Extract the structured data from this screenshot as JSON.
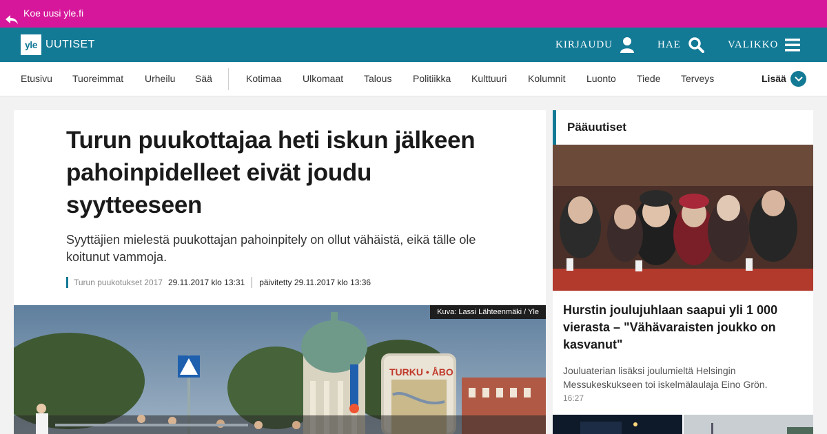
{
  "promo": {
    "text": "Koe uusi yle.fi",
    "icon": "back-arrow-icon"
  },
  "header": {
    "logo_yle": "yle",
    "logo_section": "UUTISET",
    "login_label": "KIRJAUDU",
    "search_label": "HAE",
    "menu_label": "VALIKKO"
  },
  "nav": {
    "items": [
      "Etusivu",
      "Tuoreimmat",
      "Urheilu",
      "Sää",
      "Kotimaa",
      "Ulkomaat",
      "Talous",
      "Politiikka",
      "Kulttuuri",
      "Kolumnit",
      "Luonto",
      "Tiede",
      "Terveys"
    ],
    "more_label": "Lisää"
  },
  "article": {
    "headline": "Turun puukottajaa heti iskun jälkeen pahoinpidelleet eivät joudu syytteeseen",
    "lead": "Syyttäjien mielestä puukottajan pahoinpitely on ollut vähäistä, eikä tälle ole koitunut vammoja.",
    "topic": "Turun puukotukset 2017",
    "published": "29.11.2017 klo 13:31",
    "updated": "päivitetty 29.11.2017 klo 13:36",
    "image_caption": "Kuva: Lassi Lähteenmäki / Yle",
    "image_sign_text": "TURKU • ÅBO"
  },
  "sidebar": {
    "title": "Pääuutiset",
    "headline": "Hurstin joulujuhlaan saapui yli 1 000 vierasta – \"Vähävaraisten joukko on kasvanut\"",
    "lead": "Jouluaterian lisäksi joulumieltä Helsingin Messukeskukseen toi iskelmälaulaja Eino Grön.",
    "time": "16:27"
  },
  "colors": {
    "promo": "#d6179b",
    "header": "#137a96",
    "accent": "#137a96"
  }
}
